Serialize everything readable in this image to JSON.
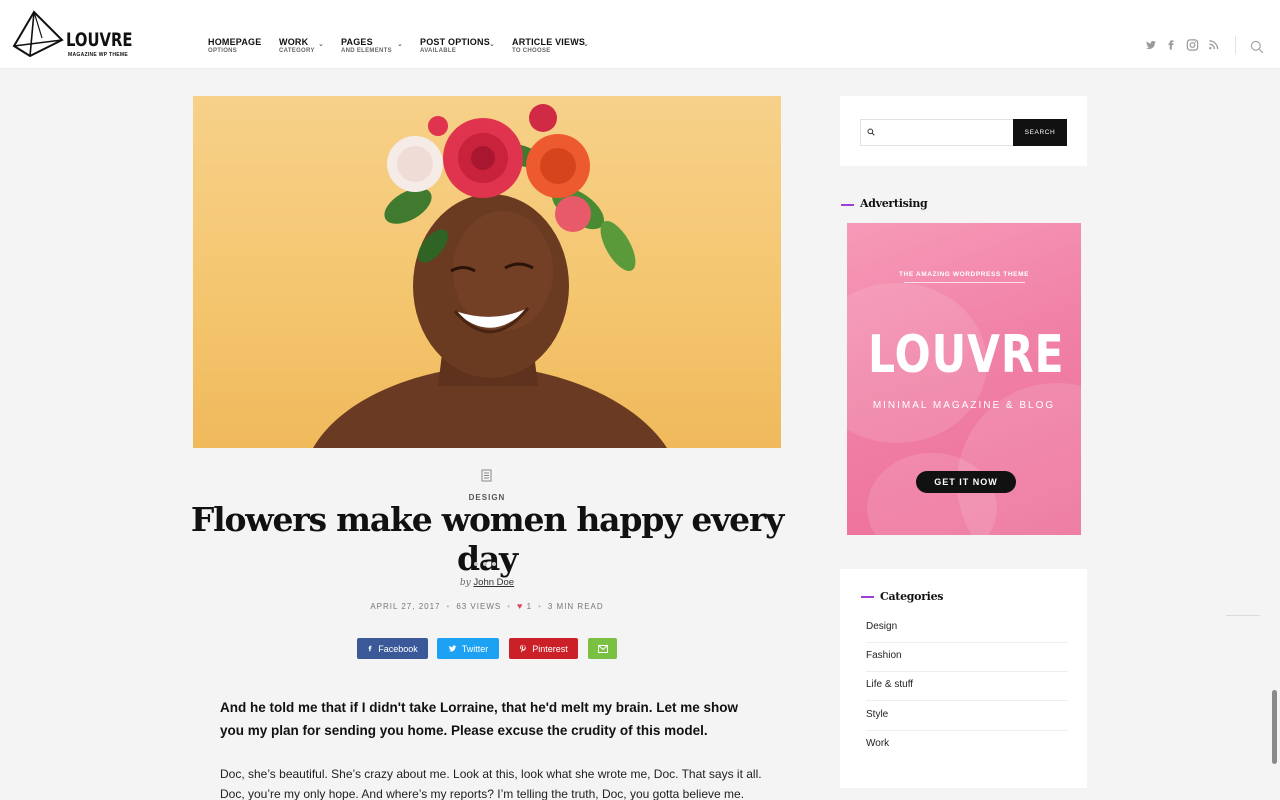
{
  "brand": {
    "name": "LOUVRE",
    "tagline": "MAGAZINE WP THEME"
  },
  "nav": [
    {
      "label": "HOMEPAGE",
      "sub": "OPTIONS",
      "dropdown": false
    },
    {
      "label": "WORK",
      "sub": "CATEGORY",
      "dropdown": true
    },
    {
      "label": "PAGES",
      "sub": "AND ELEMENTS",
      "dropdown": true
    },
    {
      "label": "POST OPTIONS",
      "sub": "AVAILABLE",
      "dropdown": true
    },
    {
      "label": "ARTICLE VIEWS",
      "sub": "TO CHOOSE",
      "dropdown": true
    }
  ],
  "header_icons": [
    "twitter-icon",
    "facebook-icon",
    "instagram-icon",
    "rss-icon",
    "search-icon"
  ],
  "post": {
    "category": "DESIGN",
    "title": "Flowers make women happy every day",
    "by": "by",
    "author": "John Doe",
    "date": "APRIL 27, 2017",
    "views": "63 VIEWS",
    "likes": "1",
    "read_time": "3 MIN READ",
    "lead": "And he told me that if I didn't take Lorraine, that he'd melt my brain. Let me show you my plan for sending you home. Please excuse the crudity of this model.",
    "body": "Doc, she’s beautiful. She’s crazy about me. Look at this, look what she wrote me, Doc. That says it all. Doc, you’re my only hope. And where’s my reports? I’m telling the truth, Doc, you gotta believe me. Yeah, exactly."
  },
  "share": [
    {
      "label": "Facebook",
      "color": "#3b5998",
      "icon": "facebook-icon"
    },
    {
      "label": "Twitter",
      "color": "#1da1f2",
      "icon": "twitter-icon"
    },
    {
      "label": "Pinterest",
      "color": "#cb2027",
      "icon": "pinterest-icon"
    },
    {
      "label": "",
      "color": "#7ac143",
      "icon": "email-icon"
    }
  ],
  "sidebar": {
    "search_button": "SEARCH",
    "search_placeholder": "",
    "advertising_title": "Advertising",
    "ad": {
      "tagline": "THE AMAZING WORDPRESS THEME",
      "headline": "LOUVRE",
      "subline": "MINIMAL MAGAZINE & BLOG",
      "cta": "GET IT NOW"
    },
    "categories_title": "Categories",
    "categories": [
      "Design",
      "Fashion",
      "Life & stuff",
      "Style",
      "Work"
    ]
  },
  "colors": {
    "accent": "#9b3fd9",
    "heart": "#e0455e"
  }
}
